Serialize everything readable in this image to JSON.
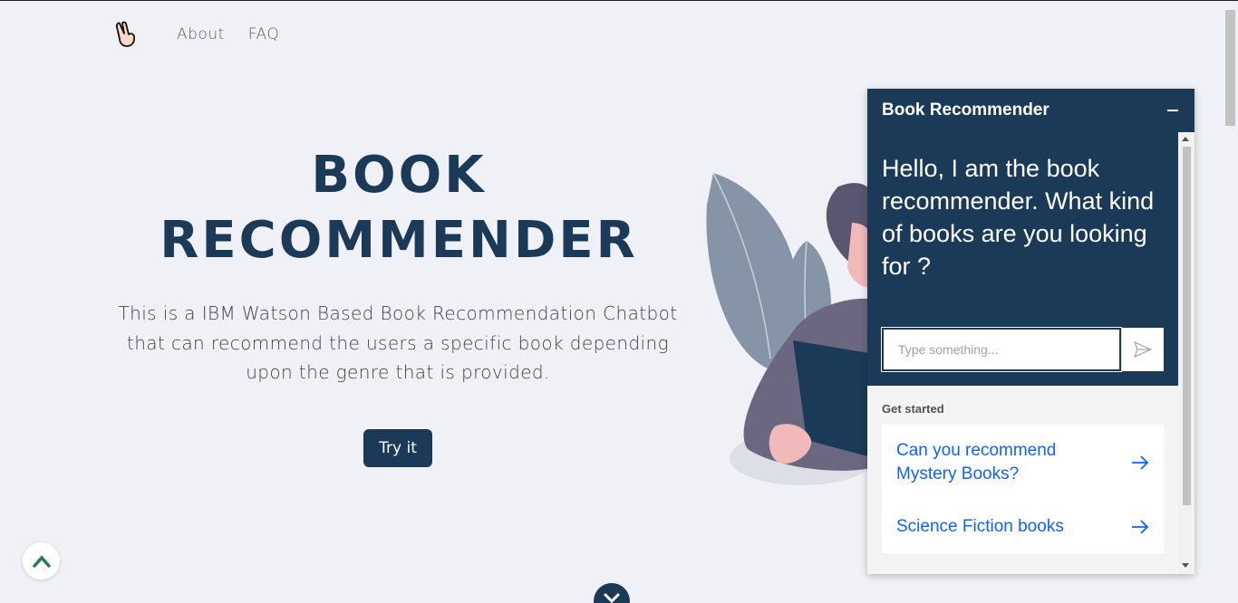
{
  "nav": {
    "logo_icon": "peace-hand-icon",
    "items": [
      {
        "label": "About"
      },
      {
        "label": "FAQ"
      }
    ]
  },
  "hero": {
    "title_line1": "BOOK",
    "title_line2": "RECOMMENDER",
    "description": "This is a IBM Watson Based Book Recommendation Chatbot that can recommend the users a specific book depending upon the genre that is provided.",
    "cta_label": "Try it"
  },
  "chat": {
    "title": "Book Recommender",
    "welcome_message": "Hello, I am the book recommender. What kind of books are you looking for ?",
    "input_placeholder": "Type something...",
    "get_started_label": "Get started",
    "options": [
      {
        "label": "Can you recommend Mystery Books?"
      },
      {
        "label": "Science Fiction books"
      }
    ]
  },
  "colors": {
    "brand": "#1a3a58",
    "link": "#0f62fe",
    "background": "#f0f1f6"
  }
}
